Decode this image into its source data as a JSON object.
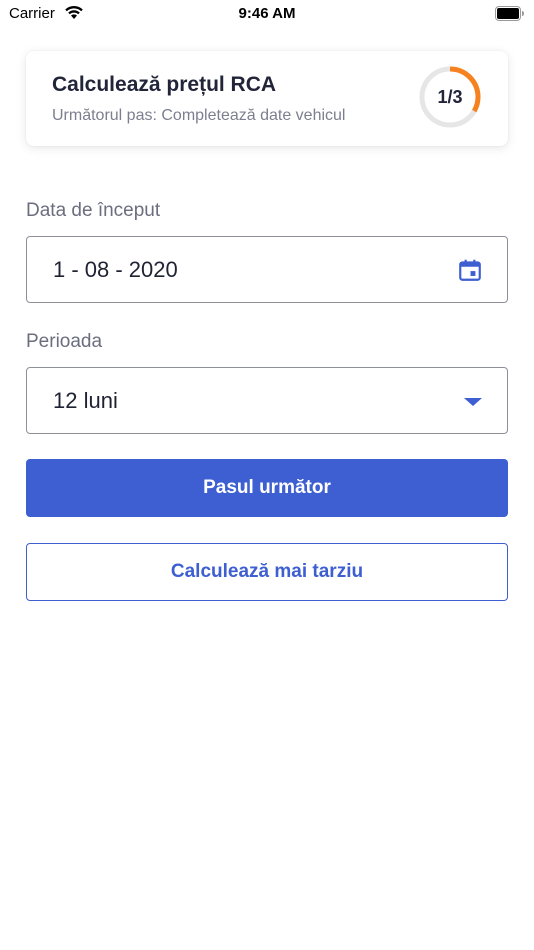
{
  "status_bar": {
    "carrier": "Carrier",
    "time": "9:46 AM"
  },
  "step_card": {
    "title": "Calculează prețul RCA",
    "subtitle": "Următorul pas: Completează date vehicul",
    "progress_label": "1/3",
    "progress_fraction": 0.3333,
    "progress_color": "#f5821f",
    "track_color": "#e6e6e6"
  },
  "form": {
    "start_date": {
      "label": "Data de început",
      "value": "1 - 08 - 2020",
      "icon": "calendar-icon"
    },
    "period": {
      "label": "Perioada",
      "value": "12 luni",
      "icon": "chevron-down-icon"
    }
  },
  "actions": {
    "next_label": "Pasul următor",
    "later_label": "Calculează mai tarziu"
  },
  "colors": {
    "accent": "#3d5fd1",
    "progress": "#f5821f"
  }
}
